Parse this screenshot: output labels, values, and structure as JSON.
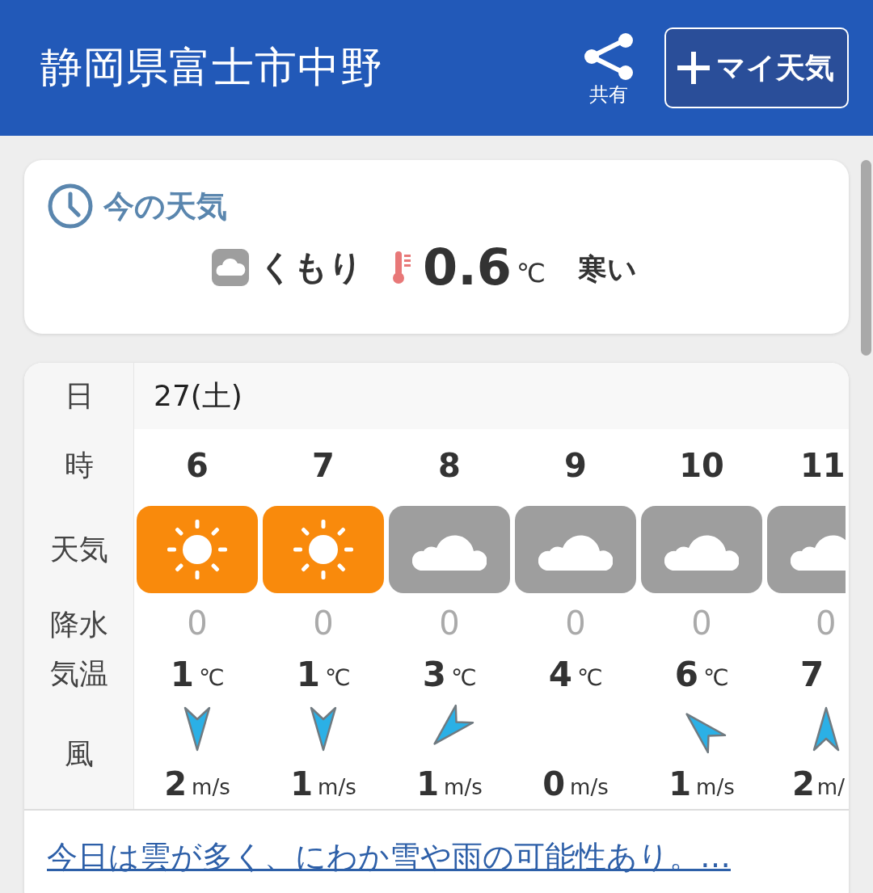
{
  "header": {
    "title": "静岡県富士市中野",
    "share_label": "共有",
    "my_weather_button": "マイ天気"
  },
  "current": {
    "heading": "今の天気",
    "kind": "cloudy",
    "condition": "くもり",
    "temperature": "0.6",
    "unit": "℃",
    "feeling": "寒い"
  },
  "forecast": {
    "row_labels": {
      "day": "日",
      "hour": "時",
      "weather": "天気",
      "precip": "降水",
      "temp": "気温",
      "wind": "風"
    },
    "date": "27(土)",
    "hours": [
      {
        "hour": "6",
        "kind": "sunny",
        "precip": "0",
        "temp": "1",
        "temp_unit": "℃",
        "wind_arrow": {
          "kind": "N"
        },
        "wind_speed": "2",
        "wind_unit": "m/s"
      },
      {
        "hour": "7",
        "kind": "sunny",
        "precip": "0",
        "temp": "1",
        "temp_unit": "℃",
        "wind_arrow": {
          "kind": "N"
        },
        "wind_speed": "1",
        "wind_unit": "m/s"
      },
      {
        "hour": "8",
        "kind": "cloudy",
        "precip": "0",
        "temp": "3",
        "temp_unit": "℃",
        "wind_arrow": {
          "kind": "NE"
        },
        "wind_speed": "1",
        "wind_unit": "m/s"
      },
      {
        "hour": "9",
        "kind": "cloudy",
        "precip": "0",
        "temp": "4",
        "temp_unit": "℃",
        "wind_speed": "0",
        "wind_unit": "m/s"
      },
      {
        "hour": "10",
        "kind": "cloudy",
        "precip": "0",
        "temp": "6",
        "temp_unit": "℃",
        "wind_arrow": {
          "kind": "SE"
        },
        "wind_speed": "1",
        "wind_unit": "m/s"
      },
      {
        "hour": "11",
        "kind": "cloudy",
        "precip": "0",
        "temp": "7",
        "wind_arrow": {
          "kind": "S"
        },
        "wind_speed": "2",
        "wind_unit": "m/"
      }
    ],
    "summary_link": "今日は雲が多く、にわか雪や雨の可能性あり。…"
  }
}
